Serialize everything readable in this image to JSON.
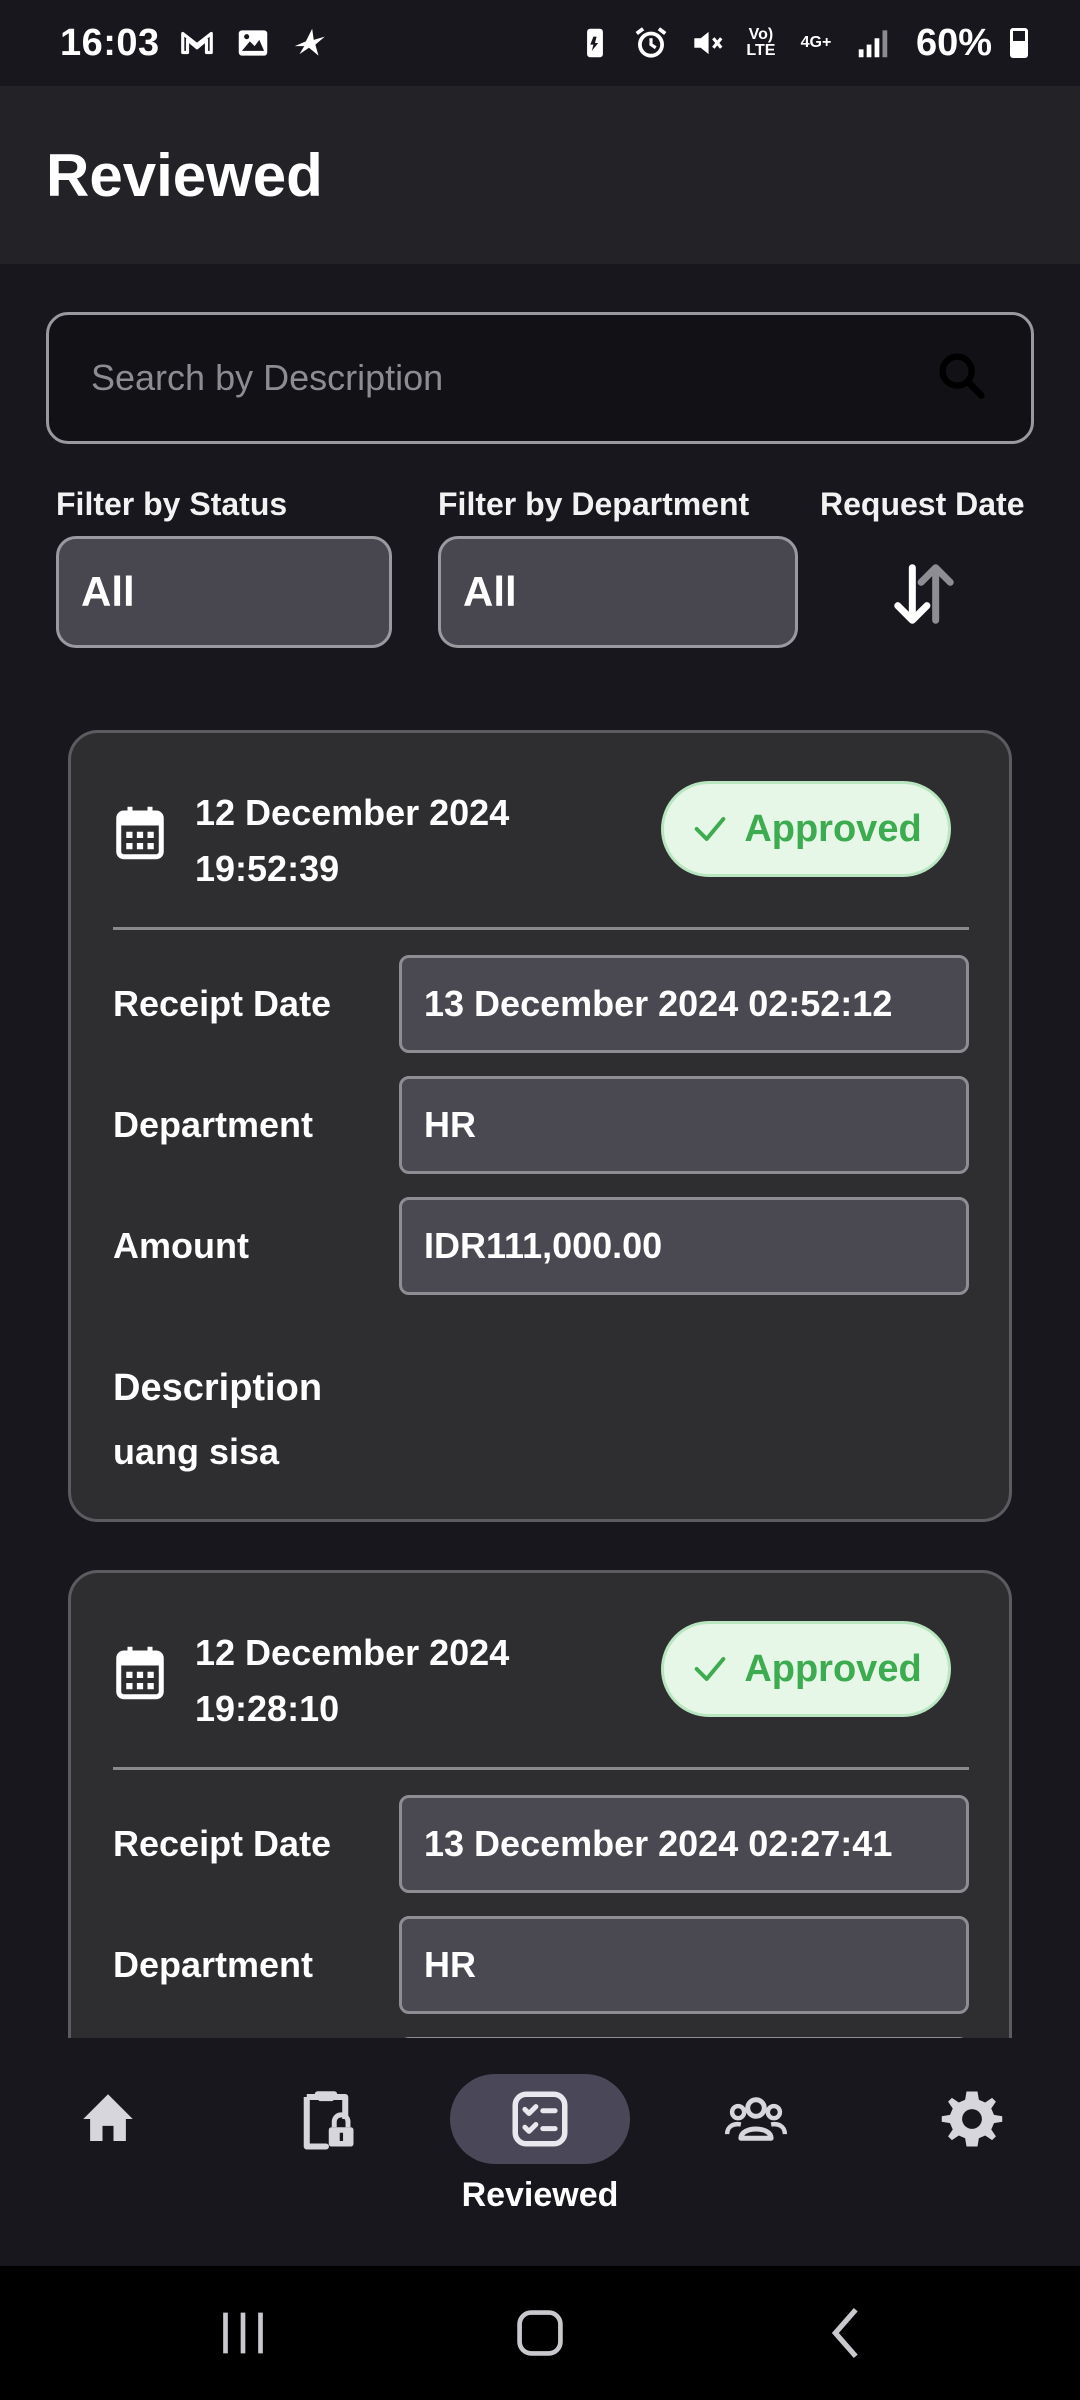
{
  "status_bar": {
    "time": "16:03",
    "battery": "60%",
    "volte": "Vo) LTE",
    "network": "4G+",
    "left_icons": [
      "gmail-icon",
      "gallery-icon",
      "bird-app-icon"
    ],
    "right_icons": [
      "battery-saver-icon",
      "alarm-icon",
      "mute-icon",
      "volte-icon",
      "network-4g-icon",
      "signal-icon",
      "battery-icon"
    ]
  },
  "header": {
    "title": "Reviewed"
  },
  "search": {
    "placeholder": "Search by Description"
  },
  "filters": {
    "status_label": "Filter by Status",
    "status_value": "All",
    "department_label": "Filter by Department",
    "department_value": "All",
    "date_label": "Request Date"
  },
  "cards": [
    {
      "date": "12 December 2024",
      "time": "19:52:39",
      "status": "Approved",
      "receipt_label": "Receipt Date",
      "receipt_value": "13 December 2024 02:52:12",
      "department_label": "Department",
      "department_value": "HR",
      "amount_label": "Amount",
      "amount_value": "IDR111,000.00",
      "description_label": "Description",
      "description_value": "uang sisa"
    },
    {
      "date": "12 December 2024",
      "time": "19:28:10",
      "status": "Approved",
      "receipt_label": "Receipt Date",
      "receipt_value": "13 December 2024 02:27:41",
      "department_label": "Department",
      "department_value": "HR"
    }
  ],
  "bottom_nav": {
    "items": [
      {
        "icon": "home-icon",
        "label": ""
      },
      {
        "icon": "clipboard-lock-icon",
        "label": ""
      },
      {
        "icon": "checklist-icon",
        "label": "Reviewed",
        "active": true
      },
      {
        "icon": "users-icon",
        "label": ""
      },
      {
        "icon": "settings-icon",
        "label": ""
      }
    ]
  },
  "colors": {
    "background": "#18171d",
    "app_bar": "#232227",
    "card": "#2e2e30",
    "field": "#4a4951",
    "approved_bg": "#e6f7e8",
    "approved_text": "#3dab4f",
    "nav_active": "#4a4858"
  }
}
